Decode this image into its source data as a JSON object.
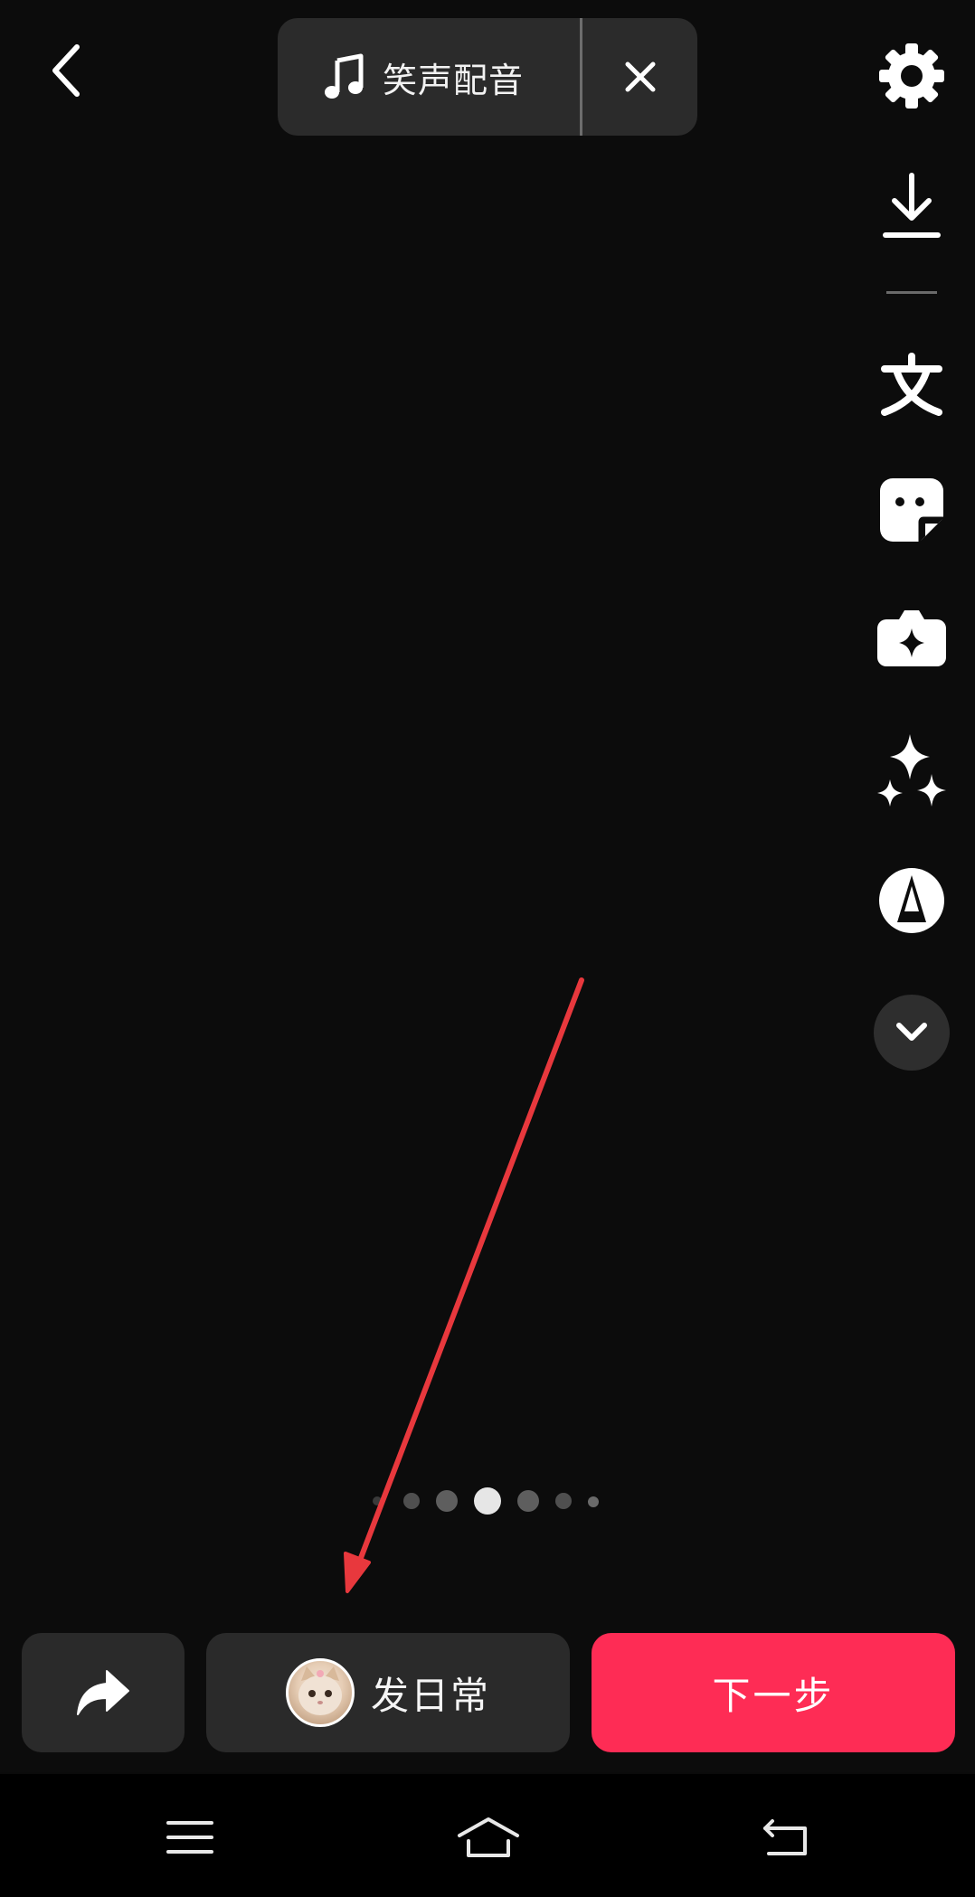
{
  "top_bar": {
    "back_icon": "chevron-left-icon",
    "music": {
      "icon": "music-note-icon",
      "label": "笑声配音",
      "close_icon": "close-icon"
    }
  },
  "right_toolbar": {
    "items": [
      {
        "name": "settings",
        "icon": "gear-icon"
      },
      {
        "name": "download",
        "icon": "download-icon"
      },
      {
        "name": "text",
        "icon": "text-icon"
      },
      {
        "name": "sticker",
        "icon": "sticker-icon"
      },
      {
        "name": "effect",
        "icon": "effect-icon"
      },
      {
        "name": "enhance",
        "icon": "sparkle-icon"
      },
      {
        "name": "filter",
        "icon": "filter-icon"
      },
      {
        "name": "expand",
        "icon": "chevron-down-icon"
      }
    ]
  },
  "page_indicator": {
    "count": 7,
    "active_index": 3
  },
  "bottom_bar": {
    "share_icon": "share-arrow-icon",
    "daily_label": "发日常",
    "next_label": "下一步"
  },
  "system_nav": {
    "menu_icon": "menu-icon",
    "home_icon": "home-icon",
    "back_icon": "back-icon"
  },
  "colors": {
    "background": "#0c0c0c",
    "panel": "#2a2a2a",
    "accent": "#fe2c55",
    "annotation": "#e8383d"
  }
}
